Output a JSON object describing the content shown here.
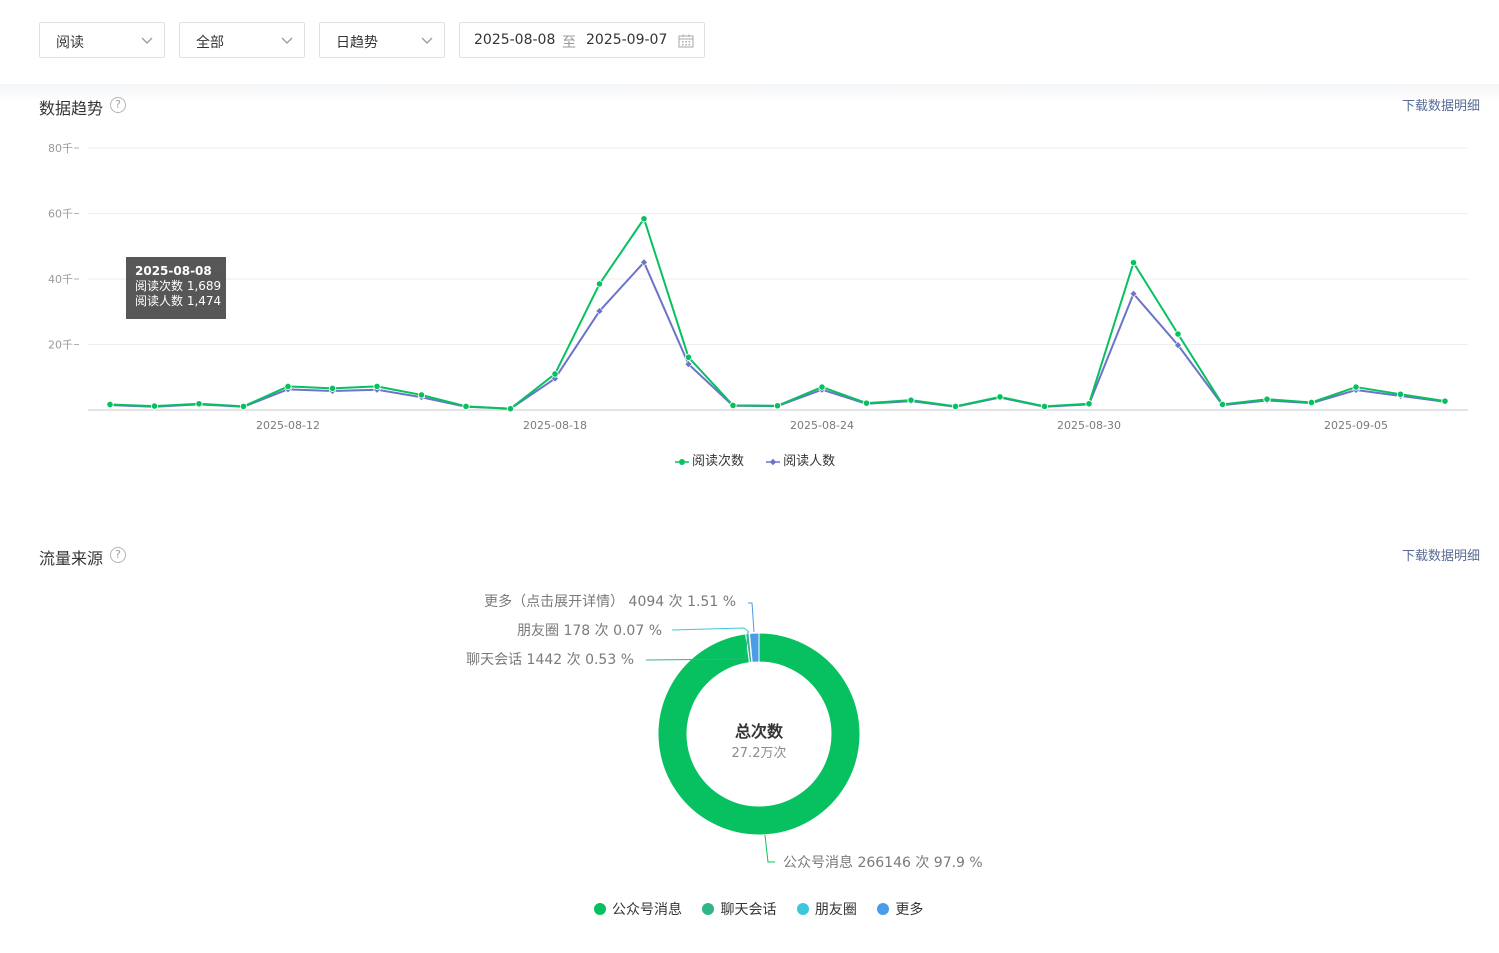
{
  "filters": {
    "metric": "阅读",
    "scope": "全部",
    "granularity": "日趋势",
    "date_start": "2025-08-08",
    "date_separator": "至",
    "date_end": "2025-09-07"
  },
  "trend_section": {
    "title": "数据趋势",
    "download": "下载数据明细",
    "tooltip": {
      "date": "2025-08-08",
      "line1": "阅读次数 1,689",
      "line2": "阅读人数 1,474"
    }
  },
  "source_section": {
    "title": "流量来源",
    "download": "下载数据明细",
    "center_title": "总次数",
    "center_value": "27.2万次",
    "labels": {
      "more": "更多（点击展开详情） 4094 次 1.51 %",
      "moments": "朋友圈 178 次 0.07 %",
      "chat": "聊天会话 1442 次 0.53 %",
      "official": "公众号消息 266146 次 97.9 %"
    }
  },
  "colors": {
    "reads": "#07c160",
    "readers": "#6b74c6",
    "official": "#07c160",
    "chat": "#2fb587",
    "moments": "#3cc8dc",
    "more": "#4a9be8"
  },
  "chart_data": [
    {
      "type": "line",
      "title": "",
      "x": [
        "2025-08-08",
        "2025-08-09",
        "2025-08-10",
        "2025-08-11",
        "2025-08-12",
        "2025-08-13",
        "2025-08-14",
        "2025-08-15",
        "2025-08-16",
        "2025-08-17",
        "2025-08-18",
        "2025-08-19",
        "2025-08-20",
        "2025-08-21",
        "2025-08-22",
        "2025-08-23",
        "2025-08-24",
        "2025-08-25",
        "2025-08-26",
        "2025-08-27",
        "2025-08-28",
        "2025-08-29",
        "2025-08-30",
        "2025-08-31",
        "2025-09-01",
        "2025-09-02",
        "2025-09-03",
        "2025-09-04",
        "2025-09-05",
        "2025-09-06",
        "2025-09-07"
      ],
      "x_tick_labels": [
        "2025-08-12",
        "2025-08-18",
        "2025-08-24",
        "2025-08-30",
        "2025-09-05"
      ],
      "y_tick_labels": [
        "20千",
        "40千",
        "60千",
        "80千"
      ],
      "ylim": [
        0,
        80000
      ],
      "grid": true,
      "legend_position": "bottom",
      "series": [
        {
          "name": "阅读次数",
          "values": [
            1689,
            1200,
            1900,
            1100,
            7200,
            6600,
            7200,
            4600,
            1100,
            400,
            11000,
            38500,
            58400,
            16100,
            1400,
            1300,
            7000,
            2100,
            3000,
            1100,
            4000,
            1100,
            1900,
            45000,
            23200,
            1700,
            3300,
            2300,
            7000,
            4800,
            2700
          ]
        },
        {
          "name": "阅读人数",
          "values": [
            1474,
            1000,
            1700,
            1000,
            6300,
            5800,
            6200,
            3900,
            1000,
            400,
            9600,
            30200,
            45100,
            14000,
            1300,
            1200,
            6200,
            1900,
            2700,
            1000,
            3800,
            1000,
            1700,
            35500,
            19800,
            1500,
            2900,
            2100,
            6100,
            4300,
            2500
          ]
        }
      ]
    },
    {
      "type": "pie",
      "title": "",
      "categories": [
        "公众号消息",
        "聊天会话",
        "朋友圈",
        "更多"
      ],
      "values": [
        266146,
        1442,
        178,
        4094
      ],
      "percent": [
        97.9,
        0.53,
        0.07,
        1.51
      ],
      "legend_position": "bottom"
    }
  ]
}
